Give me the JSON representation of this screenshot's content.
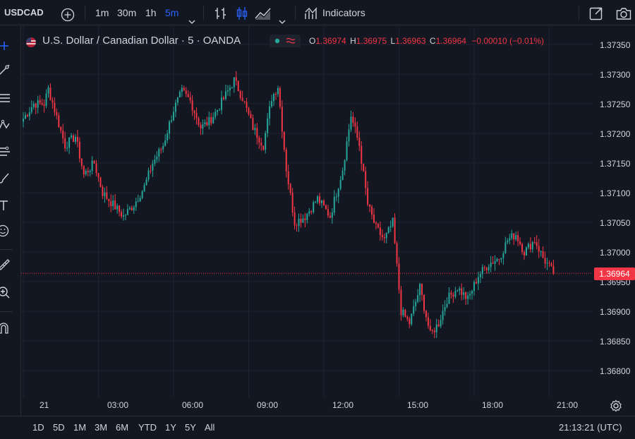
{
  "toolbar": {
    "symbol": "USDCAD",
    "intervals": [
      "1m",
      "30m",
      "1h",
      "5m"
    ],
    "active_interval": "5m",
    "indicators_label": "Indicators"
  },
  "legend": {
    "title": "U.S. Dollar / Canadian Dollar · 5 · OANDA",
    "o_key": "O",
    "o_val": "1.36974",
    "h_key": "H",
    "h_val": "1.36975",
    "l_key": "L",
    "l_val": "1.36963",
    "c_key": "C",
    "c_val": "1.36964",
    "change": "−0.00010 (−0.01%)"
  },
  "colors": {
    "background": "#131722",
    "up": "#26a69a",
    "down": "#f23645",
    "accent": "#2962ff",
    "grid": "#1f2330"
  },
  "price_axis": {
    "ticks": [
      "1.37350",
      "1.37300",
      "1.37250",
      "1.37200",
      "1.37150",
      "1.37100",
      "1.37050",
      "1.37000",
      "1.36950",
      "1.36900",
      "1.36850",
      "1.36800"
    ],
    "last_price": "1.36964"
  },
  "time_axis": {
    "ticks": [
      "21",
      "03:00",
      "06:00",
      "09:00",
      "12:00",
      "15:00",
      "18:00",
      "21:00"
    ]
  },
  "bottombar": {
    "ranges": [
      "1D",
      "5D",
      "1M",
      "3M",
      "6M",
      "YTD",
      "1Y",
      "5Y",
      "All"
    ],
    "clock": "21:13:21 (UTC)"
  },
  "chart_data": {
    "type": "candlestick",
    "ylim": [
      1.36775,
      1.37375
    ],
    "x_range": [
      "21 00:00",
      "21 21:10"
    ],
    "interval_minutes": 5,
    "last_price": 1.36964,
    "anchors": [
      [
        "00:00",
        1.37225
      ],
      [
        "00:25",
        1.3725
      ],
      [
        "00:50",
        1.3725
      ],
      [
        "01:00",
        1.37275
      ],
      [
        "01:15",
        1.3724
      ],
      [
        "01:40",
        1.3718
      ],
      [
        "02:05",
        1.37195
      ],
      [
        "02:25",
        1.3713
      ],
      [
        "02:50",
        1.3715
      ],
      [
        "03:10",
        1.371
      ],
      [
        "03:35",
        1.3708
      ],
      [
        "04:00",
        1.3706
      ],
      [
        "04:25",
        1.3708
      ],
      [
        "04:50",
        1.3711
      ],
      [
        "05:10",
        1.3715
      ],
      [
        "05:35",
        1.3718
      ],
      [
        "06:00",
        1.3724
      ],
      [
        "06:20",
        1.3727
      ],
      [
        "06:40",
        1.37255
      ],
      [
        "07:05",
        1.3721
      ],
      [
        "07:25",
        1.3722
      ],
      [
        "07:45",
        1.3724
      ],
      [
        "08:05",
        1.37265
      ],
      [
        "08:25",
        1.3729
      ],
      [
        "08:45",
        1.3726
      ],
      [
        "09:10",
        1.3721
      ],
      [
        "09:35",
        1.3718
      ],
      [
        "09:55",
        1.3726
      ],
      [
        "10:10",
        1.3728
      ],
      [
        "10:30",
        1.3714
      ],
      [
        "10:50",
        1.3705
      ],
      [
        "11:15",
        1.3706
      ],
      [
        "11:45",
        1.3709
      ],
      [
        "12:15",
        1.3706
      ],
      [
        "12:45",
        1.3714
      ],
      [
        "13:05",
        1.3723
      ],
      [
        "13:25",
        1.3718
      ],
      [
        "13:45",
        1.3708
      ],
      [
        "14:05",
        1.3704
      ],
      [
        "14:25",
        1.3702
      ],
      [
        "14:45",
        1.3705
      ],
      [
        "15:05",
        1.369
      ],
      [
        "15:25",
        1.3688
      ],
      [
        "15:50",
        1.3694
      ],
      [
        "16:15",
        1.3686
      ],
      [
        "16:35",
        1.3688
      ],
      [
        "16:55",
        1.3692
      ],
      [
        "17:20",
        1.3694
      ],
      [
        "17:45",
        1.3692
      ],
      [
        "18:10",
        1.3696
      ],
      [
        "18:35",
        1.3698
      ],
      [
        "19:00",
        1.3699
      ],
      [
        "19:20",
        1.3702
      ],
      [
        "19:40",
        1.3703
      ],
      [
        "20:00",
        1.37
      ],
      [
        "20:25",
        1.3702
      ],
      [
        "20:45",
        1.3699
      ],
      [
        "21:10",
        1.36964
      ]
    ]
  }
}
